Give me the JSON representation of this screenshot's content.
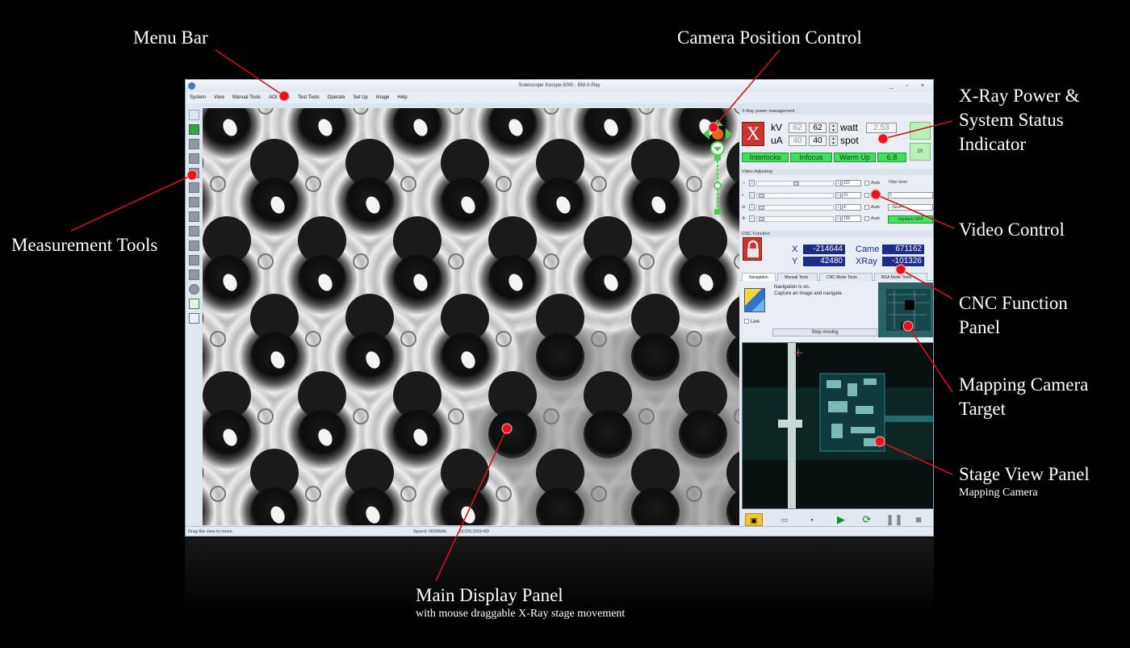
{
  "callouts": {
    "menu_bar": "Menu Bar",
    "camera_position": "Camera Position Control",
    "xray_power_1": "X-Ray Power &",
    "xray_power_2": "System Status",
    "xray_power_3": "Indicator",
    "measurement_tools": "Measurement Tools",
    "video_control": "Video Control",
    "cnc_1": "CNC Function",
    "cnc_2": "Panel",
    "mapping_target_1": "Mapping Camera",
    "mapping_target_2": "Target",
    "stage_view": "Stage View Panel",
    "stage_view_sub": "Mapping Camera",
    "main_display": "Main Display Panel",
    "main_display_sub": "with mouse draggable X-Ray stage movement"
  },
  "window": {
    "title": "Scienscope Xscope-3000 - BM-X-Ray",
    "buttons": "_ ▫ ×"
  },
  "menu": [
    "System",
    "View",
    "Manual Tools",
    "AOI Tools",
    "Test Tools",
    "Operate",
    "Set Up",
    "Image",
    "Help"
  ],
  "status_bar": {
    "hint": "Drag the view to move.",
    "speed": "Speed: NORMAL",
    "coords": "(0(100,320)=89"
  },
  "xray_panel": {
    "title": "X-Ray power management",
    "logo": "X",
    "kv_label": "kV",
    "kv_actual": "62",
    "kv_set": "62",
    "ua_label": "uA",
    "ua_actual": "40",
    "ua_set": "40",
    "watt_label": "watt",
    "watt_value": "2.53",
    "spot_label": "spot",
    "interlocks": "Interlocks",
    "infocus": "Infocus",
    "warmup": "Warm Up",
    "warmup_value": "6.8",
    "side_btn_2": "2X"
  },
  "video_panel": {
    "title": "Video Adjusting",
    "rows": [
      {
        "value": "127",
        "auto": "Auto",
        "right": "Filter level"
      },
      {
        "value": "21",
        "auto": "",
        "right": "5"
      },
      {
        "value": "4",
        "auto": "Auto",
        "right": "--Save--"
      },
      {
        "value": "100",
        "auto": "Auto",
        "right": "Joystick OFF"
      }
    ]
  },
  "cnc_panel": {
    "title": "CNC Function",
    "x_label": "X",
    "x_value": "-214644",
    "y_label": "Y",
    "y_value": "42480",
    "came_label": "Came",
    "came_value": "671162",
    "xray_label": "XRay",
    "xray_value": "-101326",
    "tabs": [
      "Navigation",
      "Manual Tests",
      "CNC Mode Tests",
      "BGA Mode Tests"
    ],
    "nav_line1": "Navigation is on.",
    "nav_line2": "Capture an image and navigate.",
    "live_label": "Live",
    "stop_button": "Stop moving"
  },
  "colors": {
    "accent_red": "#c9342e",
    "status_green": "#3ee05a",
    "cnc_blue": "#1e2b8a",
    "callout_dot": "#e8141b"
  }
}
